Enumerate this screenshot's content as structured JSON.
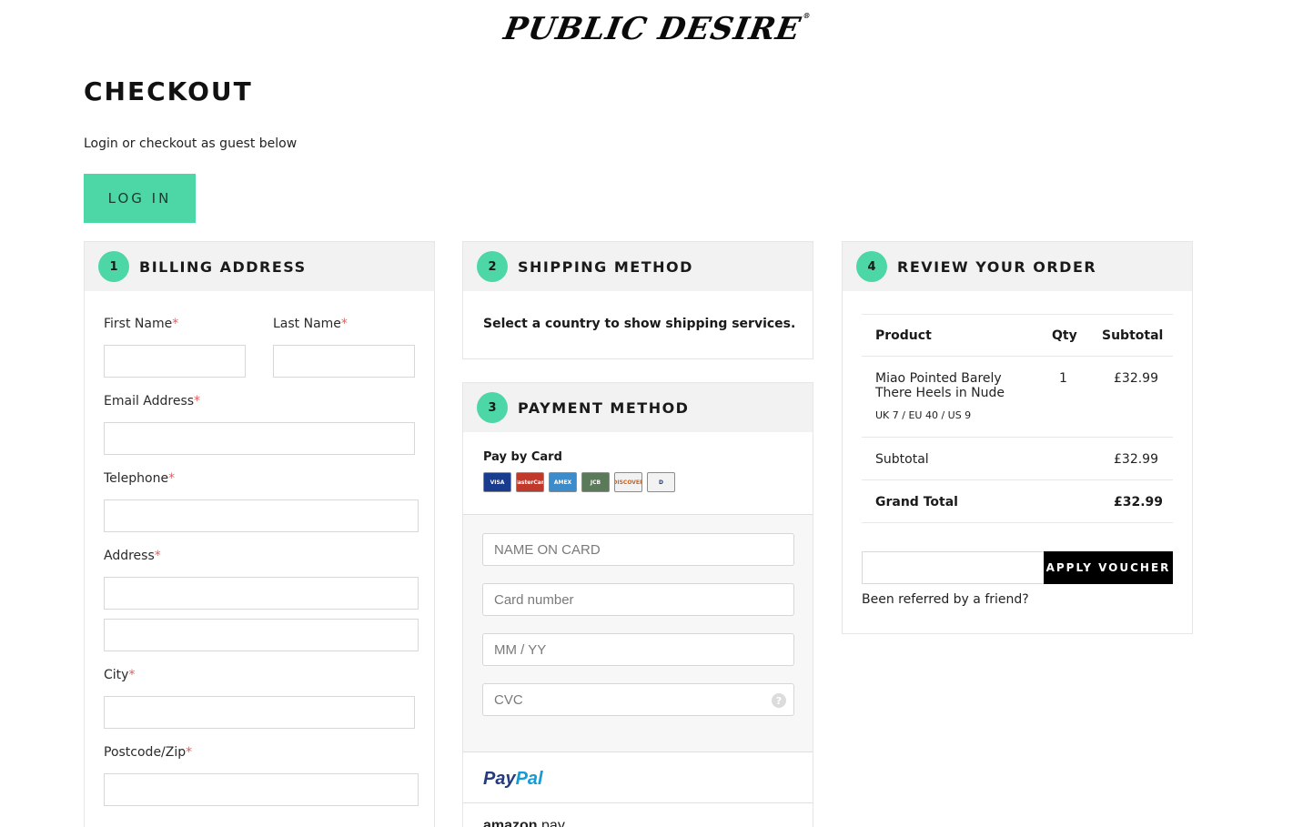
{
  "brand": {
    "logo": "PUBLIC DESIRE",
    "reg": "®"
  },
  "page": {
    "title": "CHECKOUT",
    "subtitle": "Login or checkout as guest below",
    "login_button": "LOG IN"
  },
  "billing": {
    "step": "1",
    "title": "BILLING ADDRESS",
    "required_mark": "*",
    "fields": {
      "first_name": "First Name",
      "last_name": "Last Name",
      "email": "Email Address",
      "telephone": "Telephone",
      "address": "Address",
      "city": "City",
      "postcode": "Postcode/Zip"
    }
  },
  "shipping": {
    "step": "2",
    "title": "SHIPPING METHOD",
    "message": "Select a country to show shipping services."
  },
  "payment": {
    "step": "3",
    "title": "PAYMENT METHOD",
    "pay_by_card": "Pay by Card",
    "card_icons": [
      {
        "icon": "visa-card-icon",
        "label": "VISA"
      },
      {
        "icon": "mastercard-card-icon",
        "label": "MasterCard"
      },
      {
        "icon": "amex-card-icon",
        "label": "AMEX"
      },
      {
        "icon": "jcb-card-icon",
        "label": "JCB"
      },
      {
        "icon": "discover-card-icon",
        "label": "DISCOVER"
      },
      {
        "icon": "diners-card-icon",
        "label": "D"
      }
    ],
    "name_on_card_placeholder": "NAME ON CARD",
    "card_number_placeholder": "Card number",
    "expiry_placeholder": "MM / YY",
    "cvc_placeholder": "CVC",
    "cvc_help_icon": "?",
    "paypal": {
      "part1": "Pay",
      "part2": "Pal"
    },
    "amazon": {
      "part1": "amazon",
      "part2": " pay"
    }
  },
  "review": {
    "step": "4",
    "title": "REVIEW YOUR ORDER",
    "columns": {
      "product": "Product",
      "qty": "Qty",
      "subtotal": "Subtotal"
    },
    "items": [
      {
        "name_line1": "Miao Pointed Barely",
        "name_line2": "There Heels in Nude",
        "size": "UK 7 / EU 40 / US 9",
        "qty": "1",
        "price": "£32.99"
      }
    ],
    "subtotal_label": "Subtotal",
    "subtotal_value": "£32.99",
    "grand_total_label": "Grand Total",
    "grand_total_value": "£32.99",
    "voucher_button": "APPLY VOUCHER",
    "referred_text": "Been referred by a friend?"
  },
  "colors": {
    "accent": "#4dd6a6",
    "panel_header": "#f2f2f2",
    "required": "#e06060",
    "voucher_button": "#000000"
  }
}
